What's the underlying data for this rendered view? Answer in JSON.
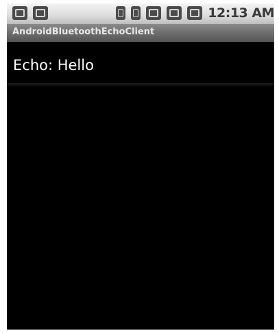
{
  "status_bar": {
    "left_icons": [
      "usb-debug-icon",
      "sd-card-icon"
    ],
    "right_icons": [
      "bluetooth-icon",
      "sim-icon",
      "network-icon",
      "signal-icon",
      "battery-icon"
    ],
    "time": "12:13 AM"
  },
  "app": {
    "title": "AndroidBluetoothEchoClient"
  },
  "main": {
    "echo_text": "Echo: Hello"
  },
  "colors": {
    "background": "#000000",
    "status_bar": "#d6d6d6",
    "title_bar": "#6b6b6b",
    "text": "#ffffff"
  }
}
